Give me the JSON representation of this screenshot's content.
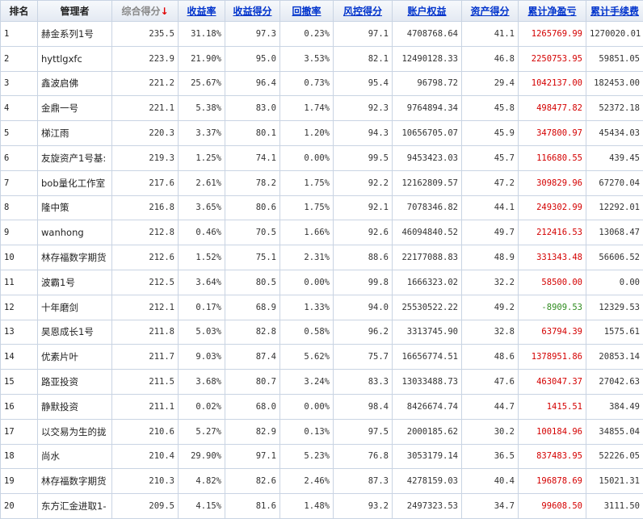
{
  "headers": {
    "rank": "排名",
    "manager": "管理者",
    "score": "综合得分",
    "score_arrow": "↓",
    "yield": "收益率",
    "yield_score": "收益得分",
    "drawdown": "回撤率",
    "risk_score": "风控得分",
    "equity": "账户权益",
    "asset_score": "资产得分",
    "net_pnl": "累计净盈亏",
    "fees": "累计手续费"
  },
  "colors": {
    "positive": "#d40000",
    "negative": "#2e8b1e",
    "link": "#0033cc",
    "border": "#c9d4e3"
  },
  "rows": [
    {
      "rank": "1",
      "name": "赫金系列1号",
      "score": "235.5",
      "yield": "31.18%",
      "yield_score": "97.3",
      "drawdown": "0.23%",
      "risk": "97.1",
      "equity": "4708768.64",
      "asset": "41.1",
      "pnl": "1265769.99",
      "pnl_sign": "pos",
      "fees": "1270020.01"
    },
    {
      "rank": "2",
      "name": "hyttlgxfc",
      "score": "223.9",
      "yield": "21.90%",
      "yield_score": "95.0",
      "drawdown": "3.53%",
      "risk": "82.1",
      "equity": "12490128.33",
      "asset": "46.8",
      "pnl": "2250753.95",
      "pnl_sign": "pos",
      "fees": "59851.05"
    },
    {
      "rank": "3",
      "name": "鑫波启佛",
      "score": "221.2",
      "yield": "25.67%",
      "yield_score": "96.4",
      "drawdown": "0.73%",
      "risk": "95.4",
      "equity": "96798.72",
      "asset": "29.4",
      "pnl": "1042137.00",
      "pnl_sign": "pos",
      "fees": "182453.00"
    },
    {
      "rank": "4",
      "name": "金鼎一号",
      "score": "221.1",
      "yield": "5.38%",
      "yield_score": "83.0",
      "drawdown": "1.74%",
      "risk": "92.3",
      "equity": "9764894.34",
      "asset": "45.8",
      "pnl": "498477.82",
      "pnl_sign": "pos",
      "fees": "52372.18"
    },
    {
      "rank": "5",
      "name": "梯江雨",
      "score": "220.3",
      "yield": "3.37%",
      "yield_score": "80.1",
      "drawdown": "1.20%",
      "risk": "94.3",
      "equity": "10656705.07",
      "asset": "45.9",
      "pnl": "347800.97",
      "pnl_sign": "pos",
      "fees": "45434.03"
    },
    {
      "rank": "6",
      "name": "友旋资产1号基:",
      "score": "219.3",
      "yield": "1.25%",
      "yield_score": "74.1",
      "drawdown": "0.00%",
      "risk": "99.5",
      "equity": "9453423.03",
      "asset": "45.7",
      "pnl": "116680.55",
      "pnl_sign": "pos",
      "fees": "439.45"
    },
    {
      "rank": "7",
      "name": "bob量化工作室",
      "score": "217.6",
      "yield": "2.61%",
      "yield_score": "78.2",
      "drawdown": "1.75%",
      "risk": "92.2",
      "equity": "12162809.57",
      "asset": "47.2",
      "pnl": "309829.96",
      "pnl_sign": "pos",
      "fees": "67270.04"
    },
    {
      "rank": "8",
      "name": "隆中策",
      "score": "216.8",
      "yield": "3.65%",
      "yield_score": "80.6",
      "drawdown": "1.75%",
      "risk": "92.1",
      "equity": "7078346.82",
      "asset": "44.1",
      "pnl": "249302.99",
      "pnl_sign": "pos",
      "fees": "12292.01"
    },
    {
      "rank": "9",
      "name": "wanhong",
      "score": "212.8",
      "yield": "0.46%",
      "yield_score": "70.5",
      "drawdown": "1.66%",
      "risk": "92.6",
      "equity": "46094840.52",
      "asset": "49.7",
      "pnl": "212416.53",
      "pnl_sign": "pos",
      "fees": "13068.47"
    },
    {
      "rank": "10",
      "name": "林存福数字期货",
      "score": "212.6",
      "yield": "1.52%",
      "yield_score": "75.1",
      "drawdown": "2.31%",
      "risk": "88.6",
      "equity": "22177088.83",
      "asset": "48.9",
      "pnl": "331343.48",
      "pnl_sign": "pos",
      "fees": "56606.52"
    },
    {
      "rank": "11",
      "name": "波霸1号",
      "score": "212.5",
      "yield": "3.64%",
      "yield_score": "80.5",
      "drawdown": "0.00%",
      "risk": "99.8",
      "equity": "1666323.02",
      "asset": "32.2",
      "pnl": "58500.00",
      "pnl_sign": "pos",
      "fees": "0.00"
    },
    {
      "rank": "12",
      "name": "十年磨剑",
      "score": "212.1",
      "yield": "0.17%",
      "yield_score": "68.9",
      "drawdown": "1.33%",
      "risk": "94.0",
      "equity": "25530522.22",
      "asset": "49.2",
      "pnl": "-8909.53",
      "pnl_sign": "neg",
      "fees": "12329.53"
    },
    {
      "rank": "13",
      "name": "昊恩成长1号",
      "score": "211.8",
      "yield": "5.03%",
      "yield_score": "82.8",
      "drawdown": "0.58%",
      "risk": "96.2",
      "equity": "3313745.90",
      "asset": "32.8",
      "pnl": "63794.39",
      "pnl_sign": "pos",
      "fees": "1575.61"
    },
    {
      "rank": "14",
      "name": "优素片叶",
      "score": "211.7",
      "yield": "9.03%",
      "yield_score": "87.4",
      "drawdown": "5.62%",
      "risk": "75.7",
      "equity": "16656774.51",
      "asset": "48.6",
      "pnl": "1378951.86",
      "pnl_sign": "pos",
      "fees": "20853.14"
    },
    {
      "rank": "15",
      "name": "路亚投资",
      "score": "211.5",
      "yield": "3.68%",
      "yield_score": "80.7",
      "drawdown": "3.24%",
      "risk": "83.3",
      "equity": "13033488.73",
      "asset": "47.6",
      "pnl": "463047.37",
      "pnl_sign": "pos",
      "fees": "27042.63"
    },
    {
      "rank": "16",
      "name": "静默投资",
      "score": "211.1",
      "yield": "0.02%",
      "yield_score": "68.0",
      "drawdown": "0.00%",
      "risk": "98.4",
      "equity": "8426674.74",
      "asset": "44.7",
      "pnl": "1415.51",
      "pnl_sign": "pos",
      "fees": "384.49"
    },
    {
      "rank": "17",
      "name": "以交易为生的拢",
      "score": "210.6",
      "yield": "5.27%",
      "yield_score": "82.9",
      "drawdown": "0.13%",
      "risk": "97.5",
      "equity": "2000185.62",
      "asset": "30.2",
      "pnl": "100184.96",
      "pnl_sign": "pos",
      "fees": "34855.04"
    },
    {
      "rank": "18",
      "name": "尚水",
      "score": "210.4",
      "yield": "29.90%",
      "yield_score": "97.1",
      "drawdown": "5.23%",
      "risk": "76.8",
      "equity": "3053179.14",
      "asset": "36.5",
      "pnl": "837483.95",
      "pnl_sign": "pos",
      "fees": "52226.05"
    },
    {
      "rank": "19",
      "name": "林存福数字期货",
      "score": "210.3",
      "yield": "4.82%",
      "yield_score": "82.6",
      "drawdown": "2.46%",
      "risk": "87.3",
      "equity": "4278159.03",
      "asset": "40.4",
      "pnl": "196878.69",
      "pnl_sign": "pos",
      "fees": "15021.31"
    },
    {
      "rank": "20",
      "name": "东方汇金进取1-",
      "score": "209.5",
      "yield": "4.15%",
      "yield_score": "81.6",
      "drawdown": "1.48%",
      "risk": "93.2",
      "equity": "2497323.53",
      "asset": "34.7",
      "pnl": "99608.50",
      "pnl_sign": "pos",
      "fees": "3111.50"
    }
  ]
}
